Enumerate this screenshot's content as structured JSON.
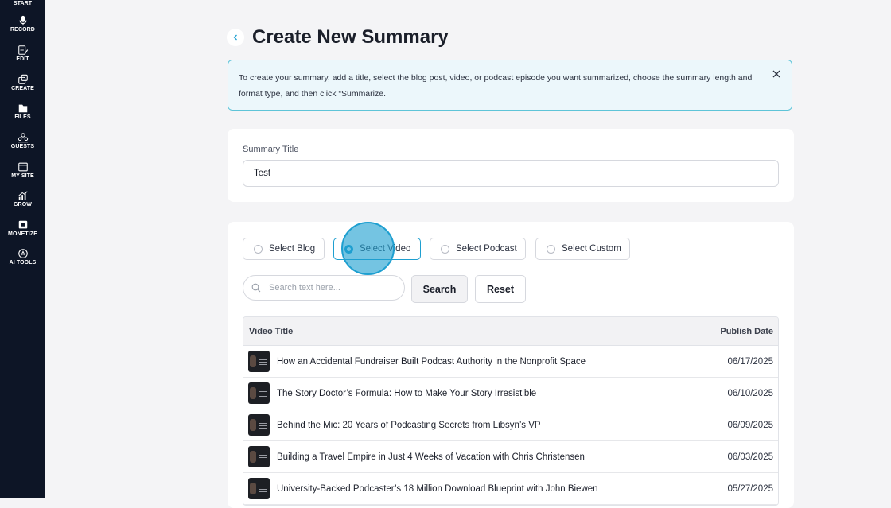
{
  "sidebar": {
    "items": [
      {
        "label": "START",
        "icon": "start-icon"
      },
      {
        "label": "RECORD",
        "icon": "microphone-icon"
      },
      {
        "label": "EDIT",
        "icon": "edit-icon"
      },
      {
        "label": "CREATE",
        "icon": "create-icon"
      },
      {
        "label": "FILES",
        "icon": "files-icon"
      },
      {
        "label": "GUESTS",
        "icon": "guests-icon"
      },
      {
        "label": "MY SITE",
        "icon": "browser-icon"
      },
      {
        "label": "GROW",
        "icon": "chart-icon"
      },
      {
        "label": "MONETIZE",
        "icon": "monetize-icon"
      },
      {
        "label": "AI TOOLS",
        "icon": "ai-tools-icon"
      }
    ]
  },
  "header": {
    "title": "Create New Summary"
  },
  "info_banner": {
    "text": "To create your summary, add a title, select the blog post, video, or podcast episode you want summarized, choose the summary length and format type, and then click “Summarize."
  },
  "summary_title": {
    "label": "Summary Title",
    "value": "Test"
  },
  "source_options": {
    "selected": "Select Video",
    "items": [
      {
        "label": "Select Blog"
      },
      {
        "label": "Select Video"
      },
      {
        "label": "Select Podcast"
      },
      {
        "label": "Select Custom"
      }
    ]
  },
  "search": {
    "placeholder": "Search text here...",
    "search_label": "Search",
    "reset_label": "Reset"
  },
  "table": {
    "columns": [
      "Video Title",
      "Publish Date"
    ],
    "rows": [
      {
        "title": "How an Accidental Fundraiser Built Podcast Authority in the Nonprofit Space",
        "date": "06/17/2025"
      },
      {
        "title": "The Story Doctor’s Formula: How to Make Your Story Irresistible",
        "date": "06/10/2025"
      },
      {
        "title": "Behind the Mic: 20 Years of Podcasting Secrets from Libsyn’s VP",
        "date": "06/09/2025"
      },
      {
        "title": "Building a Travel Empire in Just 4 Weeks of Vacation with Chris Christensen",
        "date": "06/03/2025"
      },
      {
        "title": "University-Backed Podcaster’s 18 Million Download Blueprint with John Biewen",
        "date": "05/27/2025"
      }
    ]
  },
  "colors": {
    "sidebar_bg": "#0d1526",
    "accent": "#1e9fd0",
    "banner_bg": "#ecf7fb",
    "banner_border": "#5ec4d8"
  }
}
